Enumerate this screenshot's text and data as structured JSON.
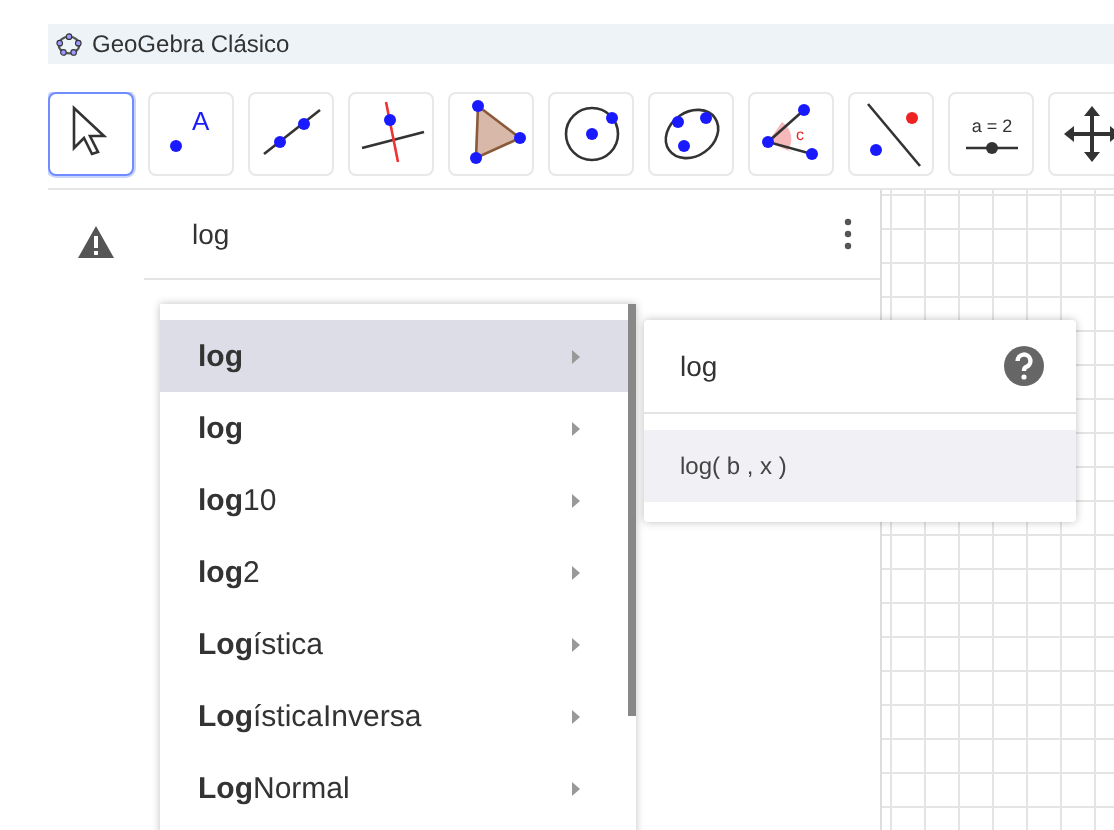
{
  "window": {
    "title": "GeoGebra Clásico"
  },
  "toolbar": [
    {
      "kind": "move",
      "selected": true
    },
    {
      "kind": "point",
      "label": "A",
      "selected": false
    },
    {
      "kind": "line",
      "selected": false
    },
    {
      "kind": "perpendicular",
      "selected": false
    },
    {
      "kind": "polygon",
      "selected": false
    },
    {
      "kind": "circle",
      "selected": false
    },
    {
      "kind": "conic",
      "selected": false
    },
    {
      "kind": "angle",
      "label": "c",
      "selected": false
    },
    {
      "kind": "reflect",
      "selected": false
    },
    {
      "kind": "slider",
      "label": "a = 2",
      "selected": false
    },
    {
      "kind": "pan",
      "selected": false
    }
  ],
  "input": {
    "value": "log"
  },
  "suggestions": [
    {
      "match": "log",
      "selected": true
    },
    {
      "match": "log",
      "selected": false
    },
    {
      "match": "log",
      "rest": "10",
      "selected": false
    },
    {
      "match": "log",
      "rest": "2",
      "selected": false
    },
    {
      "match": "Log",
      "rest": "ística",
      "selected": false
    },
    {
      "match": "Log",
      "rest": "ísticaInversa",
      "selected": false
    },
    {
      "match": "Log",
      "rest": "Normal",
      "selected": false
    }
  ],
  "submenu": {
    "title": "log",
    "items": [
      {
        "text": "log( b , x )",
        "selected": true
      }
    ]
  }
}
